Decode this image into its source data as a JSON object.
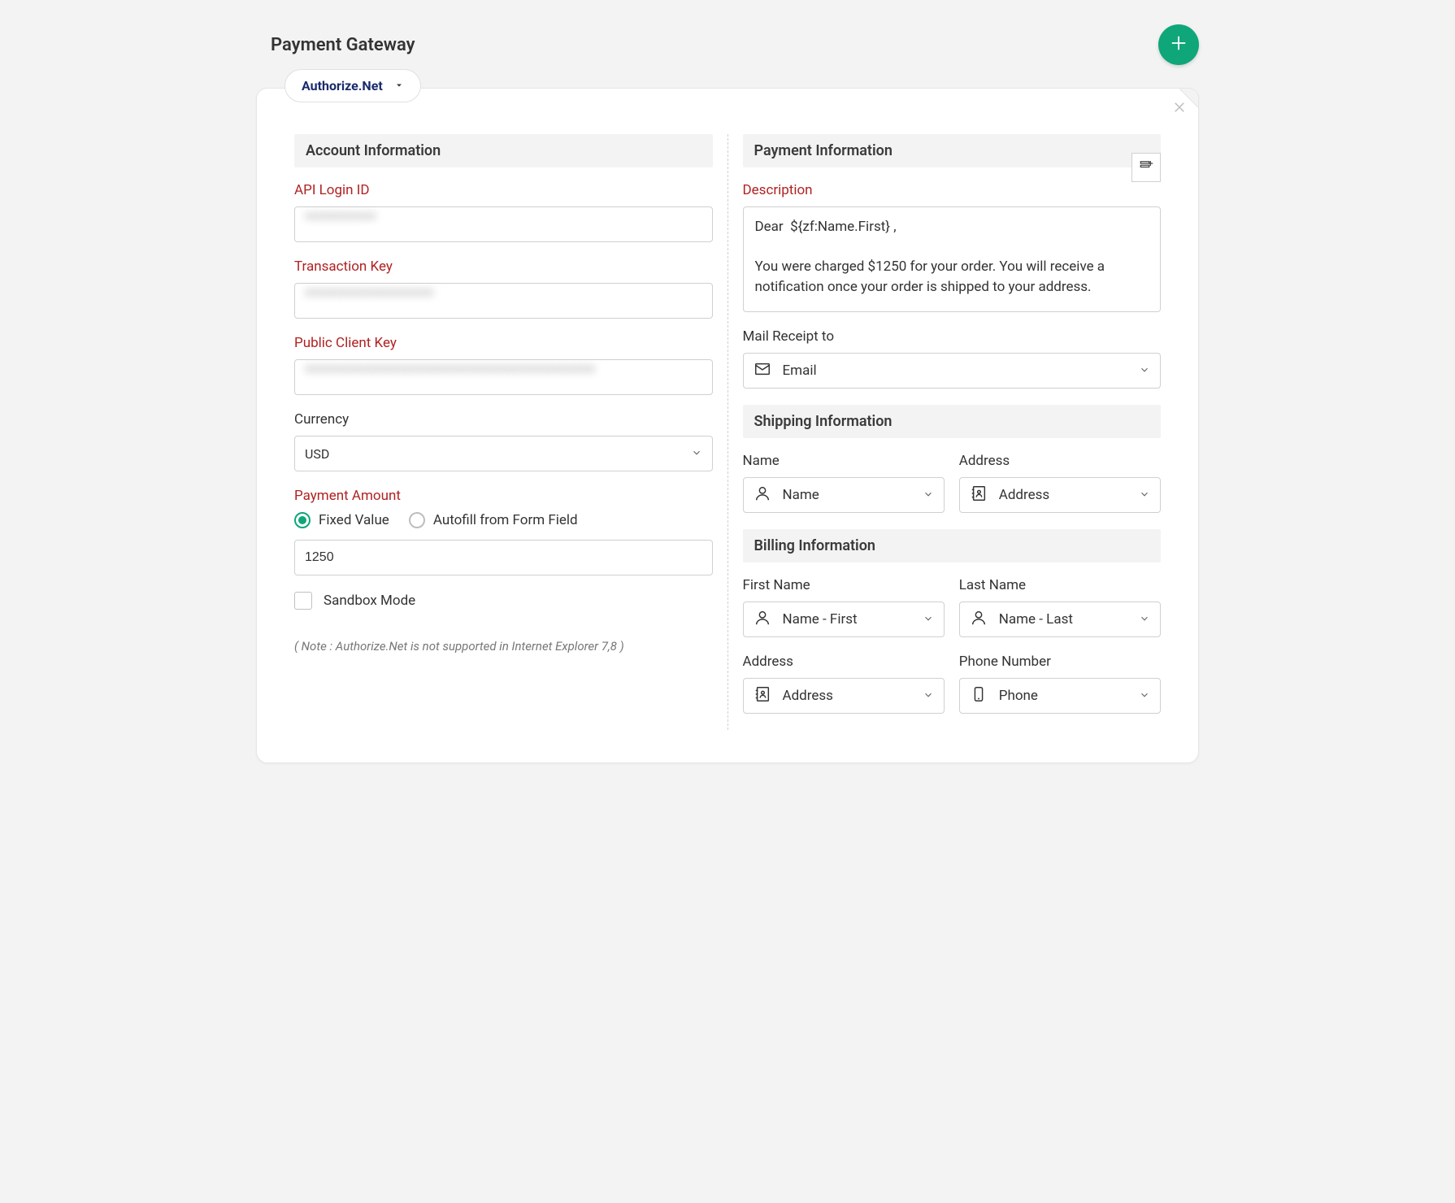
{
  "header": {
    "title": "Payment Gateway"
  },
  "gateway": {
    "selected": "Authorize.Net"
  },
  "account": {
    "section_title": "Account Information",
    "api_login_id_label": "API Login ID",
    "api_login_id_value": "xxxxxxxxxxx",
    "transaction_key_label": "Transaction Key",
    "transaction_key_value": "xxxxxxxxxxxxxxxxxxxx",
    "public_client_key_label": "Public Client Key",
    "public_client_key_value": "xxxxxxxxxxxxxxxxxxxxxxxxxxxxxxxxxxxxxxxxxxxxx",
    "currency_label": "Currency",
    "currency_value": "USD",
    "payment_amount_label": "Payment Amount",
    "payment_amount_options": {
      "fixed": "Fixed Value",
      "autofill": "Autofill from Form Field"
    },
    "payment_amount_selected": "fixed",
    "payment_amount_value": "1250",
    "sandbox_label": "Sandbox Mode",
    "sandbox_checked": false,
    "note": "( Note : Authorize.Net is not supported in Internet Explorer 7,8 )"
  },
  "payment": {
    "section_title": "Payment Information",
    "description_label": "Description",
    "description_value": "Dear  ${zf:Name.First} ,\n\nYou were charged $1250 for your order. You will receive a notification once your order is shipped to your address.",
    "mail_receipt_label": "Mail Receipt to",
    "mail_receipt_value": "Email"
  },
  "shipping": {
    "section_title": "Shipping Information",
    "name_label": "Name",
    "name_value": "Name",
    "address_label": "Address",
    "address_value": "Address"
  },
  "billing": {
    "section_title": "Billing Information",
    "first_name_label": "First Name",
    "first_name_value": "Name - First",
    "last_name_label": "Last Name",
    "last_name_value": "Name - Last",
    "address_label": "Address",
    "address_value": "Address",
    "phone_label": "Phone Number",
    "phone_value": "Phone"
  }
}
